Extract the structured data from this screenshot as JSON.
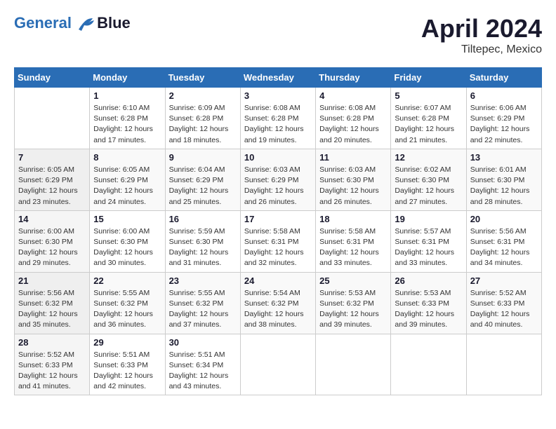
{
  "header": {
    "logo_line1": "General",
    "logo_line2": "Blue",
    "month": "April 2024",
    "location": "Tiltepec, Mexico"
  },
  "columns": [
    "Sunday",
    "Monday",
    "Tuesday",
    "Wednesday",
    "Thursday",
    "Friday",
    "Saturday"
  ],
  "weeks": [
    [
      {
        "day": "",
        "info": ""
      },
      {
        "day": "1",
        "info": "Sunrise: 6:10 AM\nSunset: 6:28 PM\nDaylight: 12 hours\nand 17 minutes."
      },
      {
        "day": "2",
        "info": "Sunrise: 6:09 AM\nSunset: 6:28 PM\nDaylight: 12 hours\nand 18 minutes."
      },
      {
        "day": "3",
        "info": "Sunrise: 6:08 AM\nSunset: 6:28 PM\nDaylight: 12 hours\nand 19 minutes."
      },
      {
        "day": "4",
        "info": "Sunrise: 6:08 AM\nSunset: 6:28 PM\nDaylight: 12 hours\nand 20 minutes."
      },
      {
        "day": "5",
        "info": "Sunrise: 6:07 AM\nSunset: 6:28 PM\nDaylight: 12 hours\nand 21 minutes."
      },
      {
        "day": "6",
        "info": "Sunrise: 6:06 AM\nSunset: 6:29 PM\nDaylight: 12 hours\nand 22 minutes."
      }
    ],
    [
      {
        "day": "7",
        "info": "Sunrise: 6:05 AM\nSunset: 6:29 PM\nDaylight: 12 hours\nand 23 minutes."
      },
      {
        "day": "8",
        "info": "Sunrise: 6:05 AM\nSunset: 6:29 PM\nDaylight: 12 hours\nand 24 minutes."
      },
      {
        "day": "9",
        "info": "Sunrise: 6:04 AM\nSunset: 6:29 PM\nDaylight: 12 hours\nand 25 minutes."
      },
      {
        "day": "10",
        "info": "Sunrise: 6:03 AM\nSunset: 6:29 PM\nDaylight: 12 hours\nand 26 minutes."
      },
      {
        "day": "11",
        "info": "Sunrise: 6:03 AM\nSunset: 6:30 PM\nDaylight: 12 hours\nand 26 minutes."
      },
      {
        "day": "12",
        "info": "Sunrise: 6:02 AM\nSunset: 6:30 PM\nDaylight: 12 hours\nand 27 minutes."
      },
      {
        "day": "13",
        "info": "Sunrise: 6:01 AM\nSunset: 6:30 PM\nDaylight: 12 hours\nand 28 minutes."
      }
    ],
    [
      {
        "day": "14",
        "info": "Sunrise: 6:00 AM\nSunset: 6:30 PM\nDaylight: 12 hours\nand 29 minutes."
      },
      {
        "day": "15",
        "info": "Sunrise: 6:00 AM\nSunset: 6:30 PM\nDaylight: 12 hours\nand 30 minutes."
      },
      {
        "day": "16",
        "info": "Sunrise: 5:59 AM\nSunset: 6:30 PM\nDaylight: 12 hours\nand 31 minutes."
      },
      {
        "day": "17",
        "info": "Sunrise: 5:58 AM\nSunset: 6:31 PM\nDaylight: 12 hours\nand 32 minutes."
      },
      {
        "day": "18",
        "info": "Sunrise: 5:58 AM\nSunset: 6:31 PM\nDaylight: 12 hours\nand 33 minutes."
      },
      {
        "day": "19",
        "info": "Sunrise: 5:57 AM\nSunset: 6:31 PM\nDaylight: 12 hours\nand 33 minutes."
      },
      {
        "day": "20",
        "info": "Sunrise: 5:56 AM\nSunset: 6:31 PM\nDaylight: 12 hours\nand 34 minutes."
      }
    ],
    [
      {
        "day": "21",
        "info": "Sunrise: 5:56 AM\nSunset: 6:32 PM\nDaylight: 12 hours\nand 35 minutes."
      },
      {
        "day": "22",
        "info": "Sunrise: 5:55 AM\nSunset: 6:32 PM\nDaylight: 12 hours\nand 36 minutes."
      },
      {
        "day": "23",
        "info": "Sunrise: 5:55 AM\nSunset: 6:32 PM\nDaylight: 12 hours\nand 37 minutes."
      },
      {
        "day": "24",
        "info": "Sunrise: 5:54 AM\nSunset: 6:32 PM\nDaylight: 12 hours\nand 38 minutes."
      },
      {
        "day": "25",
        "info": "Sunrise: 5:53 AM\nSunset: 6:32 PM\nDaylight: 12 hours\nand 39 minutes."
      },
      {
        "day": "26",
        "info": "Sunrise: 5:53 AM\nSunset: 6:33 PM\nDaylight: 12 hours\nand 39 minutes."
      },
      {
        "day": "27",
        "info": "Sunrise: 5:52 AM\nSunset: 6:33 PM\nDaylight: 12 hours\nand 40 minutes."
      }
    ],
    [
      {
        "day": "28",
        "info": "Sunrise: 5:52 AM\nSunset: 6:33 PM\nDaylight: 12 hours\nand 41 minutes."
      },
      {
        "day": "29",
        "info": "Sunrise: 5:51 AM\nSunset: 6:33 PM\nDaylight: 12 hours\nand 42 minutes."
      },
      {
        "day": "30",
        "info": "Sunrise: 5:51 AM\nSunset: 6:34 PM\nDaylight: 12 hours\nand 43 minutes."
      },
      {
        "day": "",
        "info": ""
      },
      {
        "day": "",
        "info": ""
      },
      {
        "day": "",
        "info": ""
      },
      {
        "day": "",
        "info": ""
      }
    ]
  ]
}
